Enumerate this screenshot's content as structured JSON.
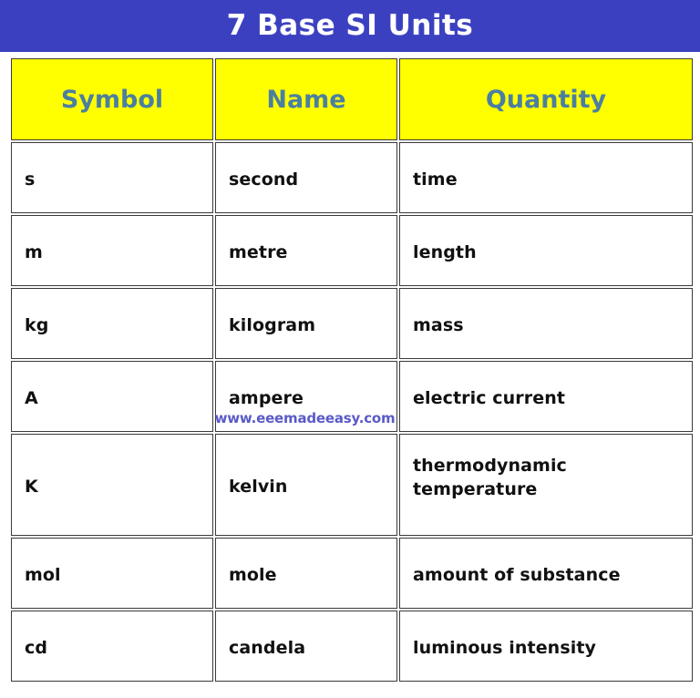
{
  "banner": {
    "title": "7 Base SI Units",
    "background_color": "#3b40c0",
    "text_color": "#ffffff"
  },
  "table": {
    "header_background_color": "#ffff00",
    "header_text_color": "#4b7fa0",
    "body_text_color": "#111111",
    "columns": [
      {
        "key": "symbol",
        "label": "Symbol"
      },
      {
        "key": "name",
        "label": "Name"
      },
      {
        "key": "quantity",
        "label": "Quantity"
      }
    ],
    "rows": [
      {
        "symbol": "s",
        "name": "second",
        "quantity": "time"
      },
      {
        "symbol": "m",
        "name": "metre",
        "quantity": "length"
      },
      {
        "symbol": "kg",
        "name": "kilogram",
        "quantity": "mass"
      },
      {
        "symbol": "A",
        "name": "ampere",
        "quantity": "electric current"
      },
      {
        "symbol": "K",
        "name": "kelvin",
        "quantity": "thermodynamic temperature"
      },
      {
        "symbol": "mol",
        "name": "mole",
        "quantity": "amount of substance"
      },
      {
        "symbol": "cd",
        "name": "candela",
        "quantity": "luminous intensity"
      }
    ]
  },
  "watermark": {
    "text": "www.eeemadeeasy.com",
    "color": "#5a5ac8"
  }
}
